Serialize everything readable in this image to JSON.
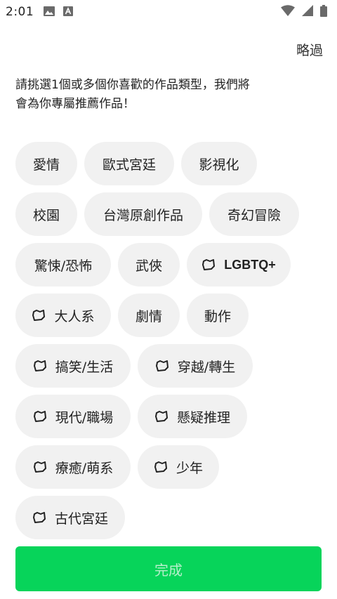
{
  "status_bar": {
    "time": "2:01",
    "left_icons": [
      "image-icon",
      "a-box-icon"
    ],
    "right_icons": [
      "wifi-icon",
      "signal-icon",
      "battery-icon"
    ]
  },
  "header": {
    "skip_label": "略過"
  },
  "prompt": {
    "text": "請挑選1個或多個你喜歡的作品類型，我們將會為你專屬推薦作品！"
  },
  "genres": [
    {
      "label": "愛情",
      "icon": ""
    },
    {
      "label": "歐式宮廷",
      "icon": ""
    },
    {
      "label": "影視化",
      "icon": ""
    },
    {
      "label": "校園",
      "icon": ""
    },
    {
      "label": "台灣原創作品",
      "icon": ""
    },
    {
      "label": "奇幻冒險",
      "icon": ""
    },
    {
      "label": "驚悚/恐怖",
      "icon": ""
    },
    {
      "label": "武俠",
      "icon": ""
    },
    {
      "label": "LGBTQ+",
      "icon": "mature-tag-icon"
    },
    {
      "label": "大人系",
      "icon": "mature-tag-icon"
    },
    {
      "label": "劇情",
      "icon": ""
    },
    {
      "label": "動作",
      "icon": ""
    },
    {
      "label": "搞笑/生活",
      "icon": "mature-tag-icon"
    },
    {
      "label": "穿越/轉生",
      "icon": "mature-tag-icon"
    },
    {
      "label": "現代/職場",
      "icon": "mature-tag-icon"
    },
    {
      "label": "懸疑推理",
      "icon": "mature-tag-icon"
    },
    {
      "label": "療癒/萌系",
      "icon": "mature-tag-icon"
    },
    {
      "label": "少年",
      "icon": "mature-tag-icon"
    },
    {
      "label": "古代宮廷",
      "icon": "mature-tag-icon"
    }
  ],
  "footer": {
    "done_label": "完成"
  },
  "colors": {
    "accent": "#07d45a",
    "accent_text_disabled": "#b6efcb",
    "chip_background": "#f1f1f1"
  }
}
